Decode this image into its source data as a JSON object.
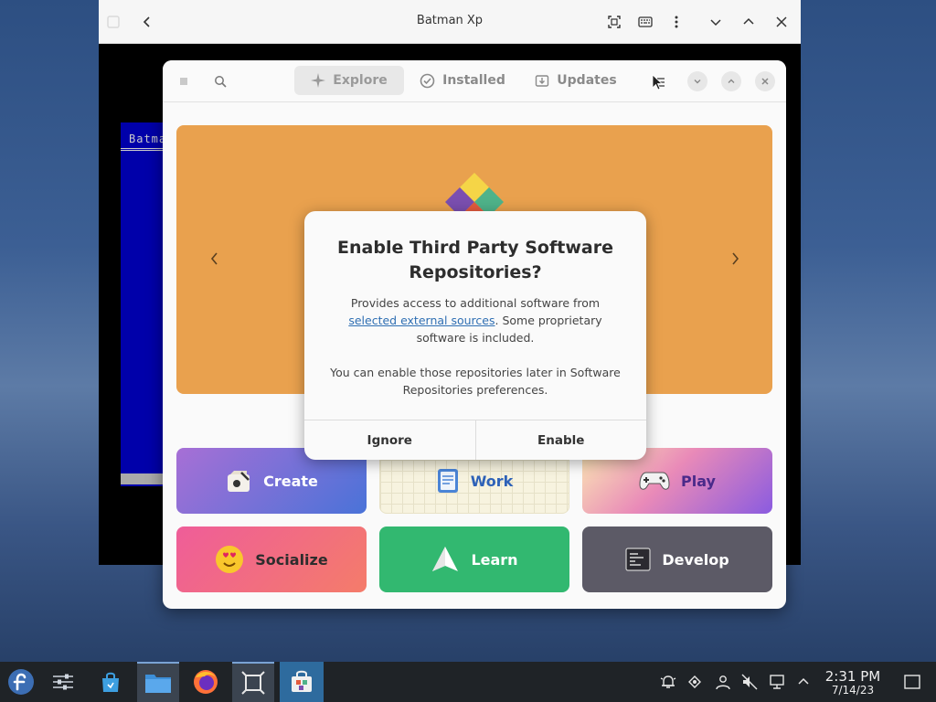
{
  "outer_window": {
    "title": "Batman Xp",
    "dos_text": "Batma"
  },
  "software_window": {
    "tabs": [
      {
        "label": "Explore",
        "icon": "sparkle-icon",
        "active": true
      },
      {
        "label": "Installed",
        "icon": "check-circle-icon",
        "active": false
      },
      {
        "label": "Updates",
        "icon": "download-icon",
        "active": false
      }
    ],
    "categories": [
      {
        "label": "Create",
        "icon": "create-icon"
      },
      {
        "label": "Work",
        "icon": "work-icon"
      },
      {
        "label": "Play",
        "icon": "gamepad-icon"
      },
      {
        "label": "Socialize",
        "icon": "smiley-icon"
      },
      {
        "label": "Learn",
        "icon": "paper-plane-icon"
      },
      {
        "label": "Develop",
        "icon": "terminal-icon"
      }
    ]
  },
  "dialog": {
    "title": "Enable Third Party Software Repositories?",
    "body_prefix": "Provides access to additional software from",
    "body_link": "selected external sources",
    "body_suffix": ". Some proprietary software is included.",
    "body2": "You can enable those repositories later in Software Repositories preferences.",
    "ignore_label": "Ignore",
    "enable_label": "Enable"
  },
  "taskbar": {
    "time": "2:31 PM",
    "date": "7/14/23"
  },
  "colors": {
    "banner": "#e9a14e",
    "link": "#2f6fb3",
    "taskbar": "#1f2327"
  }
}
